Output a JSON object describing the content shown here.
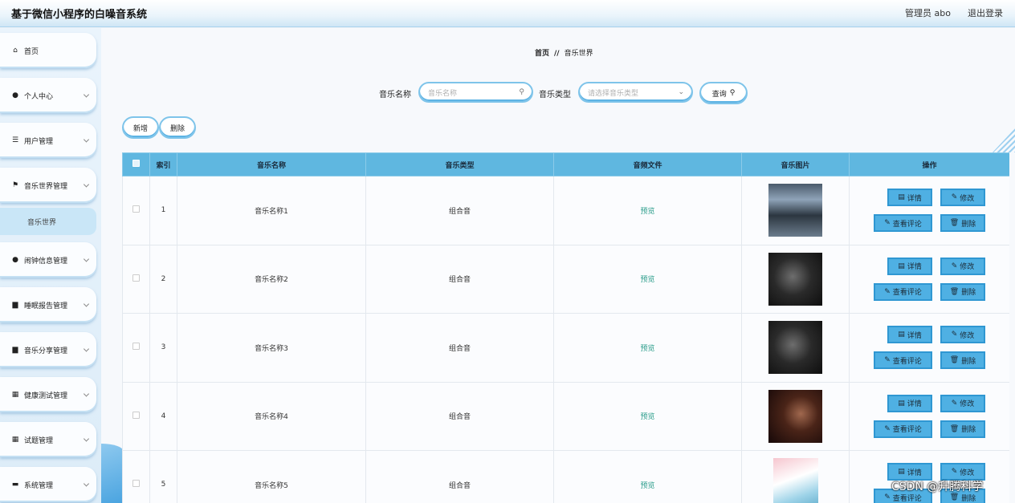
{
  "header": {
    "title": "基于微信小程序的白噪音系统",
    "admin": "管理员 abo",
    "logout": "退出登录"
  },
  "sidebar": {
    "items": [
      {
        "label": "首页",
        "icon": "home-icon",
        "glyph": "⌂"
      },
      {
        "label": "个人中心",
        "icon": "user-icon",
        "glyph": "●"
      },
      {
        "label": "用户管理",
        "icon": "list-icon",
        "glyph": "☰"
      },
      {
        "label": "音乐世界管理",
        "icon": "flag-icon",
        "glyph": "⚑"
      },
      {
        "label": "闹钟信息管理",
        "icon": "user-icon",
        "glyph": "●"
      },
      {
        "label": "睡眠报告管理",
        "icon": "briefcase-icon",
        "glyph": "▆"
      },
      {
        "label": "音乐分享管理",
        "icon": "briefcase-icon",
        "glyph": "▆"
      },
      {
        "label": "健康测试管理",
        "icon": "grid-icon",
        "glyph": "▦"
      },
      {
        "label": "试题管理",
        "icon": "grid-icon",
        "glyph": "▦"
      },
      {
        "label": "系统管理",
        "icon": "database-icon",
        "glyph": "▬"
      }
    ],
    "sub_item": "音乐世界"
  },
  "breadcrumb": {
    "home": "首页",
    "sep": "//",
    "current": "音乐世界"
  },
  "search": {
    "name_label": "音乐名称",
    "name_placeholder": "音乐名称",
    "type_label": "音乐类型",
    "type_placeholder": "请选择音乐类型",
    "query_label": "查询"
  },
  "actions": {
    "add_label": "新增",
    "delete_label": "删除"
  },
  "table": {
    "headers": [
      "",
      "索引",
      "音乐名称",
      "音乐类型",
      "音频文件",
      "音乐图片",
      "操作"
    ],
    "rows": [
      {
        "index": "1",
        "name": "音乐名称1",
        "type": "组合音",
        "file": "预览"
      },
      {
        "index": "2",
        "name": "音乐名称2",
        "type": "组合音",
        "file": "预览"
      },
      {
        "index": "3",
        "name": "音乐名称3",
        "type": "组合音",
        "file": "预览"
      },
      {
        "index": "4",
        "name": "音乐名称4",
        "type": "组合音",
        "file": "预览"
      },
      {
        "index": "5",
        "name": "音乐名称5",
        "type": "组合音",
        "file": "预览"
      }
    ],
    "ops": {
      "detail": "详情",
      "edit": "修改",
      "comments": "查看评论",
      "delete": "删除"
    }
  },
  "watermark": "CSDN @升腾科学",
  "colors": {
    "header_blue": "#5fb7e0",
    "button_blue": "#4fb0e3",
    "preview_green": "#2a9c8a"
  }
}
